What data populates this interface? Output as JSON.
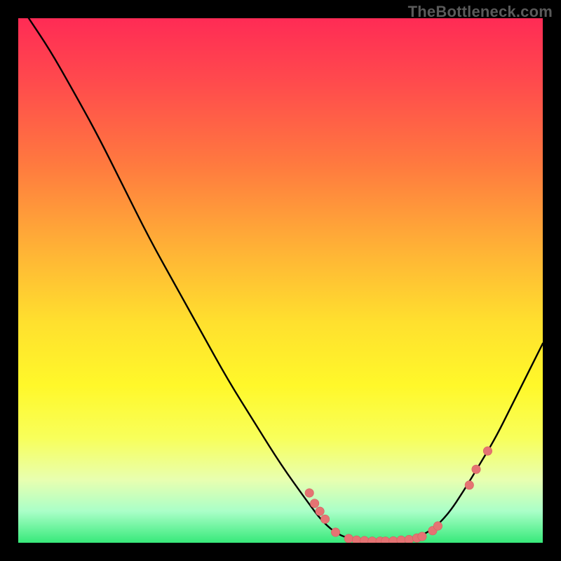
{
  "watermark": "TheBottleneck.com",
  "colors": {
    "curve_stroke": "#000000",
    "dot_fill": "#e57373",
    "dot_stroke": "#d45f5f"
  },
  "chart_data": {
    "type": "line",
    "title": "",
    "xlabel": "",
    "ylabel": "",
    "xlim": [
      0,
      100
    ],
    "ylim": [
      0,
      100
    ],
    "curve": [
      {
        "x": 2,
        "y": 100
      },
      {
        "x": 6,
        "y": 94
      },
      {
        "x": 10,
        "y": 87
      },
      {
        "x": 15,
        "y": 78
      },
      {
        "x": 20,
        "y": 68
      },
      {
        "x": 25,
        "y": 58
      },
      {
        "x": 30,
        "y": 49
      },
      {
        "x": 35,
        "y": 40
      },
      {
        "x": 40,
        "y": 31
      },
      {
        "x": 45,
        "y": 23
      },
      {
        "x": 50,
        "y": 15
      },
      {
        "x": 55,
        "y": 8
      },
      {
        "x": 58,
        "y": 4
      },
      {
        "x": 61,
        "y": 1.5
      },
      {
        "x": 64,
        "y": 0.6
      },
      {
        "x": 68,
        "y": 0.3
      },
      {
        "x": 72,
        "y": 0.4
      },
      {
        "x": 76,
        "y": 1.0
      },
      {
        "x": 79,
        "y": 2.5
      },
      {
        "x": 82,
        "y": 5.5
      },
      {
        "x": 85,
        "y": 10
      },
      {
        "x": 88,
        "y": 15
      },
      {
        "x": 91,
        "y": 20
      },
      {
        "x": 94,
        "y": 26
      },
      {
        "x": 97,
        "y": 32
      },
      {
        "x": 100,
        "y": 38
      }
    ],
    "points": [
      {
        "x": 55.5,
        "y": 9.5
      },
      {
        "x": 56.5,
        "y": 7.5
      },
      {
        "x": 57.5,
        "y": 6.0
      },
      {
        "x": 58.5,
        "y": 4.5
      },
      {
        "x": 60.5,
        "y": 2.0
      },
      {
        "x": 63.0,
        "y": 0.8
      },
      {
        "x": 64.5,
        "y": 0.5
      },
      {
        "x": 66.0,
        "y": 0.4
      },
      {
        "x": 67.5,
        "y": 0.3
      },
      {
        "x": 69.0,
        "y": 0.3
      },
      {
        "x": 70.0,
        "y": 0.3
      },
      {
        "x": 71.5,
        "y": 0.35
      },
      {
        "x": 73.0,
        "y": 0.5
      },
      {
        "x": 74.5,
        "y": 0.6
      },
      {
        "x": 76.0,
        "y": 0.9
      },
      {
        "x": 77.0,
        "y": 1.2
      },
      {
        "x": 79.0,
        "y": 2.3
      },
      {
        "x": 80.0,
        "y": 3.2
      },
      {
        "x": 86.0,
        "y": 11.0
      },
      {
        "x": 87.3,
        "y": 14.0
      },
      {
        "x": 89.5,
        "y": 17.5
      }
    ]
  }
}
